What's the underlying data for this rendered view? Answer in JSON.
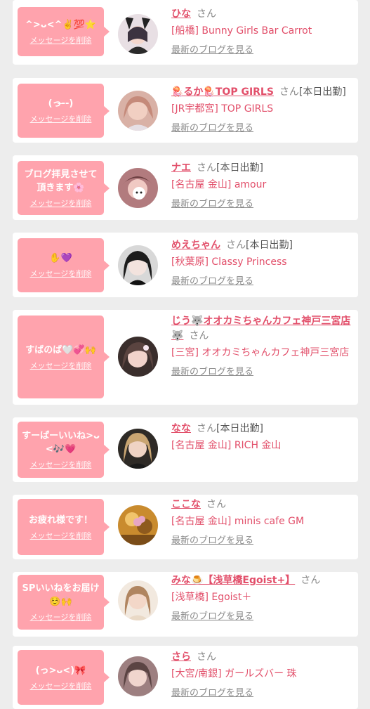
{
  "cards": [
    {
      "message": "^>ᴗ<^✌️💯⭐",
      "delete_label": "メッセージを削除",
      "name": "ひな",
      "honorific": "さん",
      "status": "",
      "shop": "[船橋] Bunny Girls Bar Carrot",
      "blog_link": "最新のブログを見る",
      "avatar_color": "#3c3340"
    },
    {
      "message": "(っ-̶-)",
      "delete_label": "メッセージを削除",
      "name": "🪼るか🪼TOP GIRLS",
      "honorific": "さん",
      "status": "[本日出勤]",
      "shop": "[JR宇都宮] TOP GIRLS",
      "blog_link": "最新のブログを見る",
      "avatar_color": "#c58a7a"
    },
    {
      "message": "ブログ拝見させて頂きます🌸",
      "delete_label": "メッセージを削除",
      "name": "ナエ",
      "honorific": "さん",
      "status": "[本日出勤]",
      "shop": "[名古屋 金山] amour",
      "blog_link": "最新のブログを見る",
      "avatar_color": "#b27b7e"
    },
    {
      "message": "✋💜",
      "delete_label": "メッセージを削除",
      "name": "めえちゃん",
      "honorific": "さん",
      "status": "[本日出勤]",
      "shop": "[秋葉原] Classy Princess",
      "blog_link": "最新のブログを見る",
      "avatar_color": "#d8d8d8"
    },
    {
      "message": "すばのば🤍💞🙌",
      "delete_label": "メッセージを削除",
      "name": "じう🐺オオカミちゃんカフェ神戸三宮店🐺",
      "honorific": "さん",
      "status": "",
      "shop": "[三宮] オオカミちゃんカフェ神戸三宮店",
      "blog_link": "最新のブログを見る",
      "avatar_color": "#5a4440"
    },
    {
      "message": "すーぱーいいね>ᴗ<🎶💗",
      "delete_label": "メッセージを削除",
      "name": "なな",
      "honorific": "さん",
      "status": "[本日出勤]",
      "shop": "[名古屋 金山] RICH 金山",
      "blog_link": "最新のブログを見る",
      "avatar_color": "#6a5a48"
    },
    {
      "message": "お疲れ様です！",
      "delete_label": "メッセージを削除",
      "name": "ここな",
      "honorific": "さん",
      "status": "",
      "shop": "[名古屋 金山] minis cafe GM",
      "blog_link": "最新のブログを見る",
      "avatar_color": "#c98b2e"
    },
    {
      "message": "SPいいねをお届け☺️🙌",
      "delete_label": "メッセージを削除",
      "name": "みな🍮【浅草橋Egoist+】",
      "honorific": "さん",
      "status": "",
      "shop": "[浅草橋] Egoist＋",
      "blog_link": "最新のブログを見る",
      "avatar_color": "#e9d9c6"
    },
    {
      "message": "(っ>ᴗ<)🎀",
      "delete_label": "メッセージを削除",
      "name": "さら",
      "honorific": "さん",
      "status": "",
      "shop": "[大宮/南銀] ガールズバー 珠",
      "blog_link": "最新のブログを見る",
      "avatar_color": "#9d7f80"
    }
  ]
}
